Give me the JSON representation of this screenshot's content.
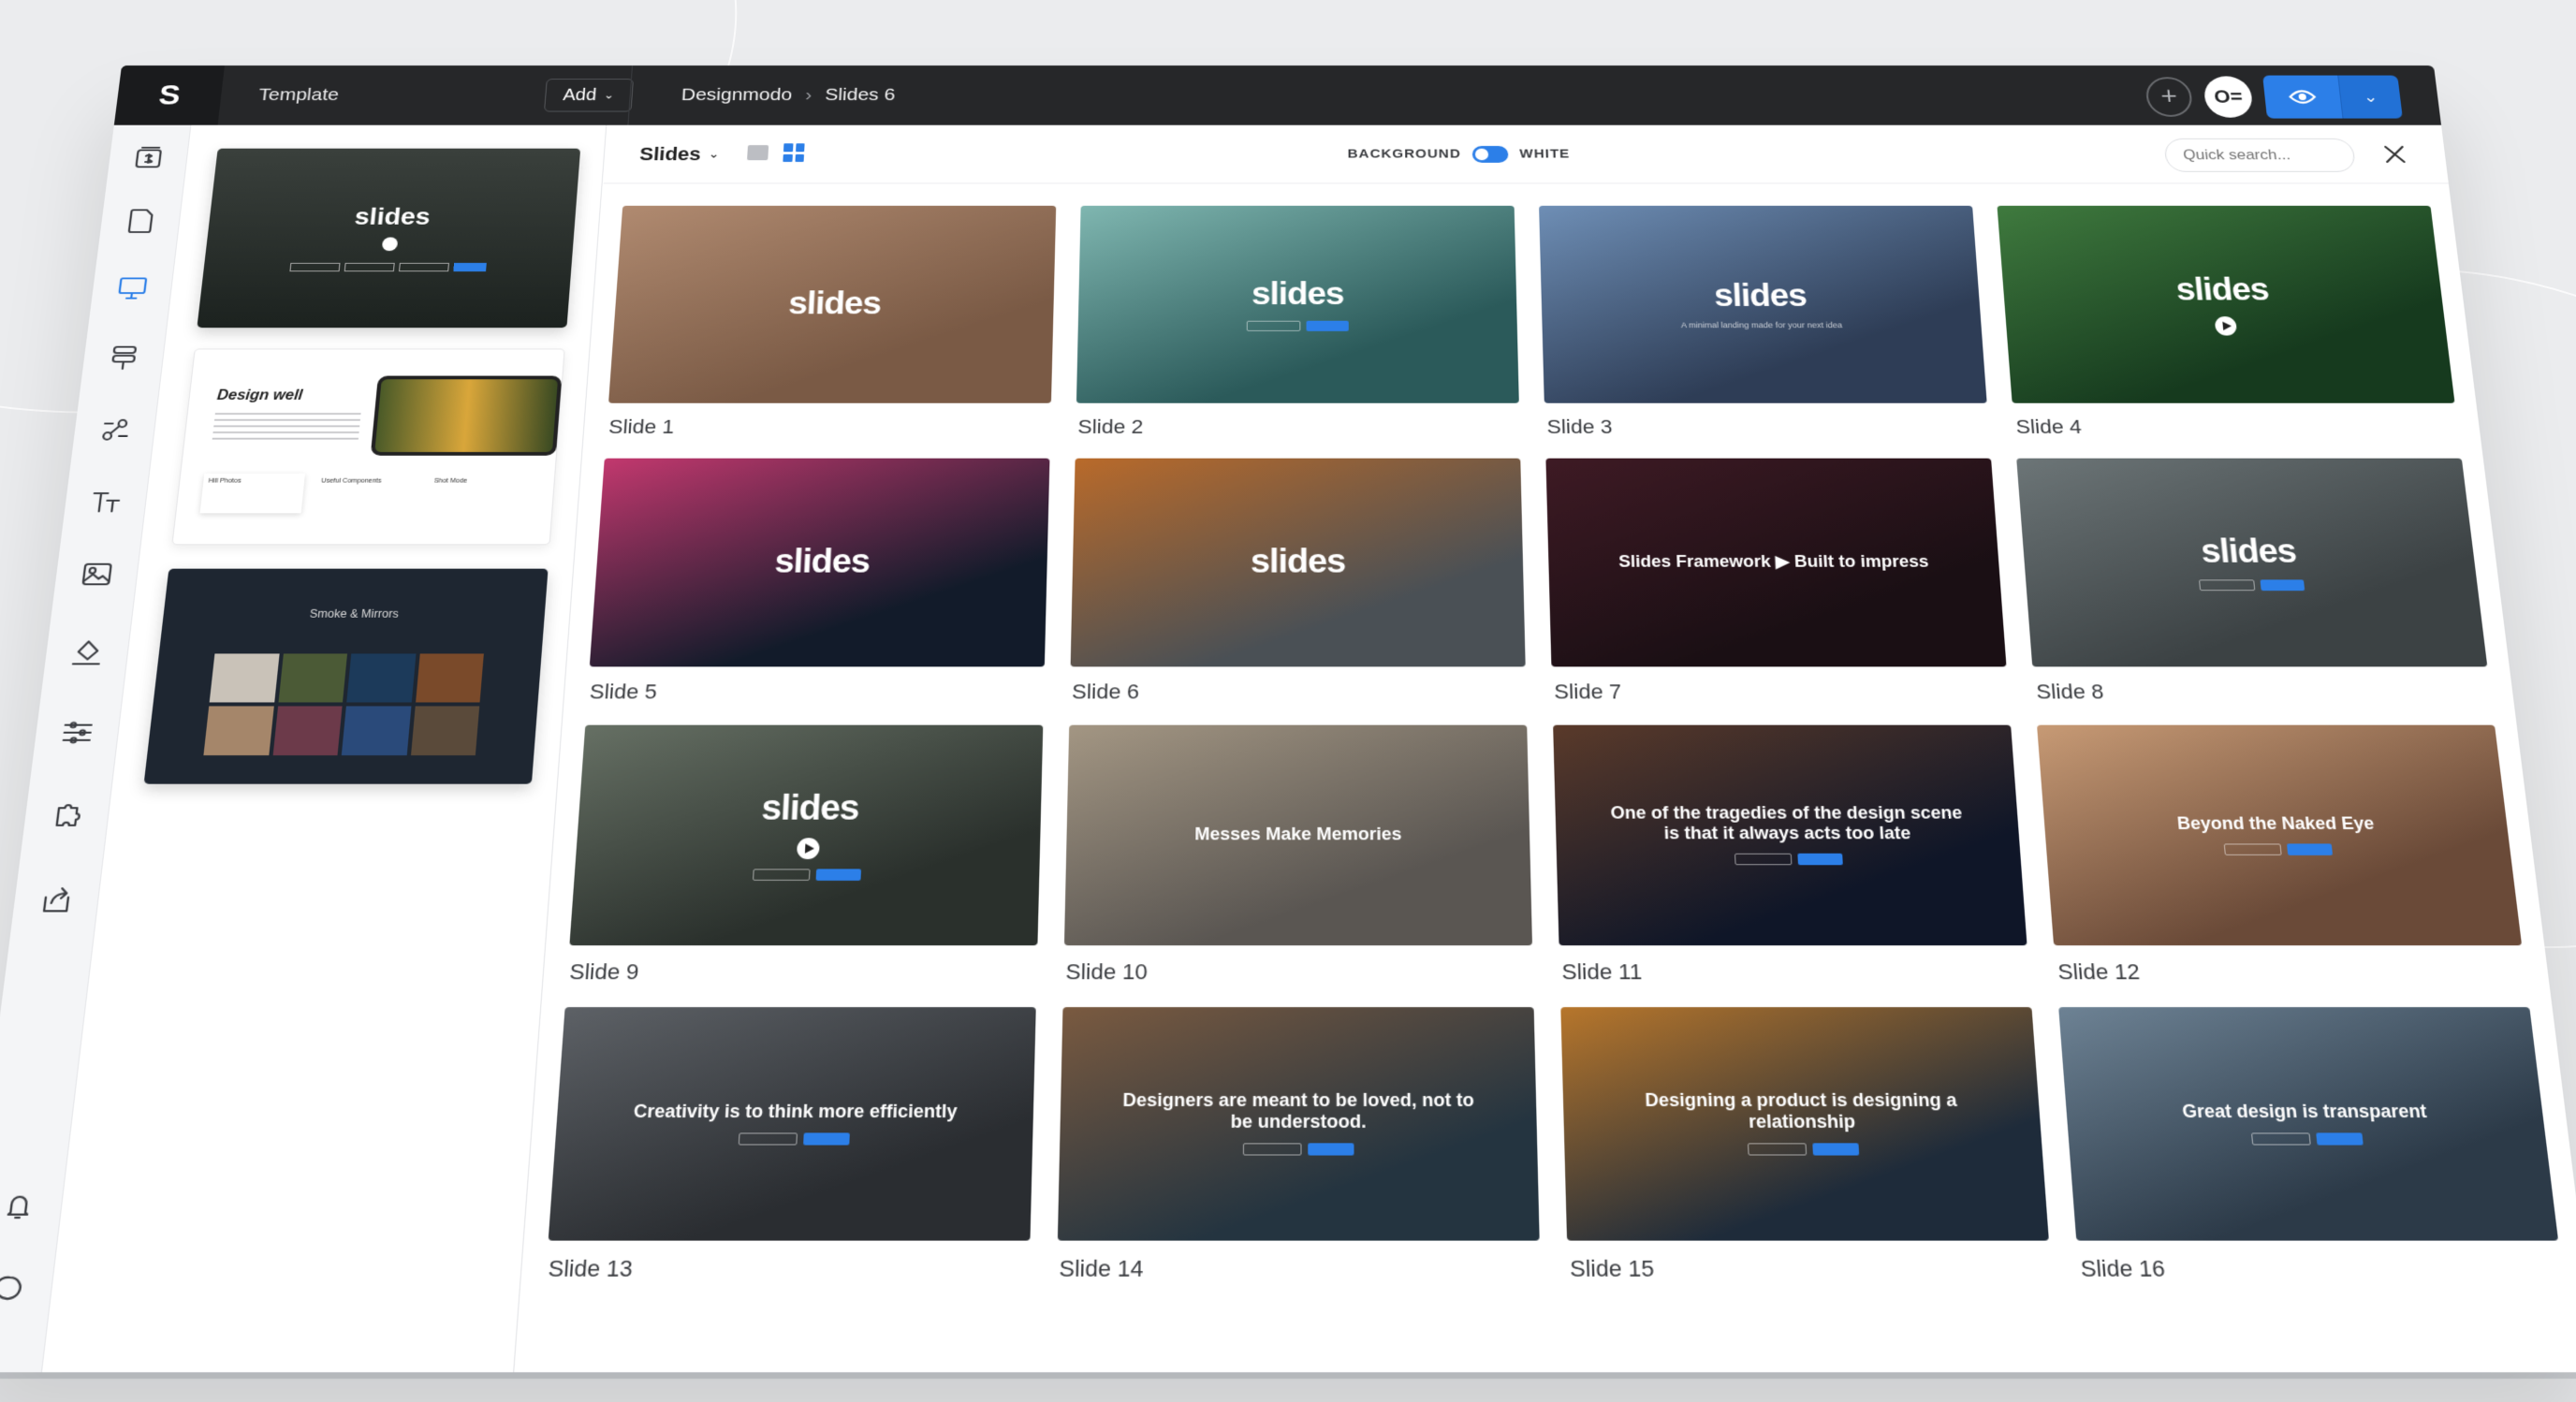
{
  "topbar": {
    "logo": "S",
    "template_title": "Template",
    "add_label": "Add",
    "breadcrumb": [
      "Designmodo",
      "Slides 6"
    ],
    "avatar_initials": "O="
  },
  "toolbar": {
    "slides_label": "Slides",
    "background_label": "BACKGROUND",
    "white_label": "WHITE",
    "search_placeholder": "Quick search..."
  },
  "rail": {
    "top_icons": [
      "slides-icon",
      "page-icon",
      "desktop-icon",
      "layout-icon",
      "components-icon",
      "typography-icon",
      "image-icon",
      "paint-icon",
      "settings-icon",
      "plugin-icon",
      "export-icon"
    ],
    "bottom_icons": [
      "bell-icon",
      "chat-icon"
    ]
  },
  "templates": [
    {
      "title": "slides",
      "theme": "forest"
    },
    {
      "title": "Design well",
      "theme": "light",
      "captions": [
        "Hill Photos",
        "Useful Components",
        "Shot Mode"
      ]
    },
    {
      "title": "Smoke & Mirrors",
      "theme": "dark-gallery"
    }
  ],
  "slides": [
    {
      "label": "Slide 1",
      "heading": "slides",
      "style": "big",
      "bg": "#7a5a45",
      "bg2": "#b08a70"
    },
    {
      "label": "Slide 2",
      "heading": "slides",
      "style": "big",
      "bg": "#2b5a5a",
      "bg2": "#7fb6b0",
      "cta": true
    },
    {
      "label": "Slide 3",
      "heading": "slides",
      "style": "big",
      "bg": "#2e3d56",
      "bg2": "#6e8eb5",
      "sub": "A minimal landing made for your next idea"
    },
    {
      "label": "Slide 4",
      "heading": "slides",
      "style": "big",
      "bg": "#163a1e",
      "bg2": "#3f7a3e",
      "play": true
    },
    {
      "label": "Slide 5",
      "heading": "slides",
      "style": "big",
      "bg": "#121b2a",
      "bg2": "#c2386e"
    },
    {
      "label": "Slide 6",
      "heading": "slides",
      "style": "big",
      "bg": "#4a5055",
      "bg2": "#b96a2a"
    },
    {
      "label": "Slide 7",
      "heading": "Slides Framework  ▶  Built to impress",
      "style": "head",
      "bg": "#1a0f14",
      "bg2": "#3e1a24"
    },
    {
      "label": "Slide 8",
      "heading": "slides",
      "style": "big",
      "bg": "#3c4244",
      "bg2": "#6c7577",
      "cta": true
    },
    {
      "label": "Slide 9",
      "heading": "slides",
      "style": "big",
      "bg": "#2a302c",
      "bg2": "#667064",
      "play": true,
      "cta": true
    },
    {
      "label": "Slide 10",
      "heading": "Messes Make Memories",
      "style": "head",
      "bg": "#5a5652",
      "bg2": "#a39683"
    },
    {
      "label": "Slide 11",
      "heading": "One of the tragedies of the design scene is that it always acts too late",
      "style": "head",
      "bg": "#0f1628",
      "bg2": "#5a3a2a",
      "cta": true
    },
    {
      "label": "Slide 12",
      "heading": "Beyond the Naked Eye",
      "style": "head",
      "bg": "#6a4a38",
      "bg2": "#c79a75",
      "cta": true
    },
    {
      "label": "Slide 13",
      "heading": "Creativity is to think more efficiently",
      "style": "head",
      "bg": "#2a2d31",
      "bg2": "#5d6166",
      "cta": true
    },
    {
      "label": "Slide 14",
      "heading": "Designers are meant to be loved, not to be understood.",
      "style": "head",
      "bg": "#243440",
      "bg2": "#7a5a40",
      "cta": true
    },
    {
      "label": "Slide 15",
      "heading": "Designing a product is designing a relationship",
      "style": "head",
      "bg": "#1e2b3a",
      "bg2": "#b7762b",
      "cta": true
    },
    {
      "label": "Slide 16",
      "heading": "Great design is transparent",
      "style": "head",
      "bg": "#2c3a48",
      "bg2": "#6d8294",
      "cta": true
    }
  ],
  "colors": {
    "accent": "#2c7fe8",
    "topbar": "#262729"
  }
}
